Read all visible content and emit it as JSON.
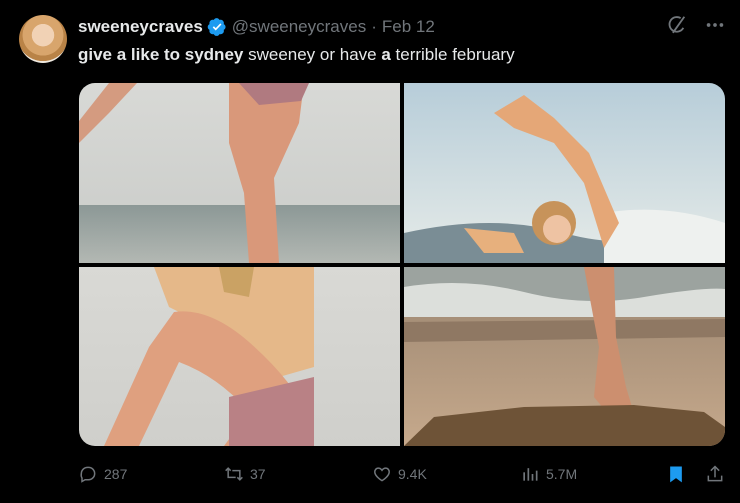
{
  "tweet": {
    "display_name": "sweeneycraves",
    "handle": "@sweeneycraves",
    "separator": "·",
    "date": "Feb 12",
    "text": {
      "part1": "give a like to sydney",
      "part2": " sweeney or have ",
      "part3": "a",
      "part4": " terrible february"
    }
  },
  "metrics": {
    "replies": "287",
    "reposts": "37",
    "likes": "9.4K",
    "views": "5.7M"
  },
  "icons": {
    "verified": "verified-badge-icon",
    "grok": "grok-icon",
    "more": "more-icon",
    "reply": "reply-icon",
    "repost": "repost-icon",
    "like": "like-icon",
    "views": "views-icon",
    "bookmark": "bookmark-icon",
    "share": "share-icon"
  },
  "colors": {
    "background": "#000000",
    "text": "#e7e9ea",
    "muted": "#71767b",
    "accent": "#1d9bf0"
  }
}
